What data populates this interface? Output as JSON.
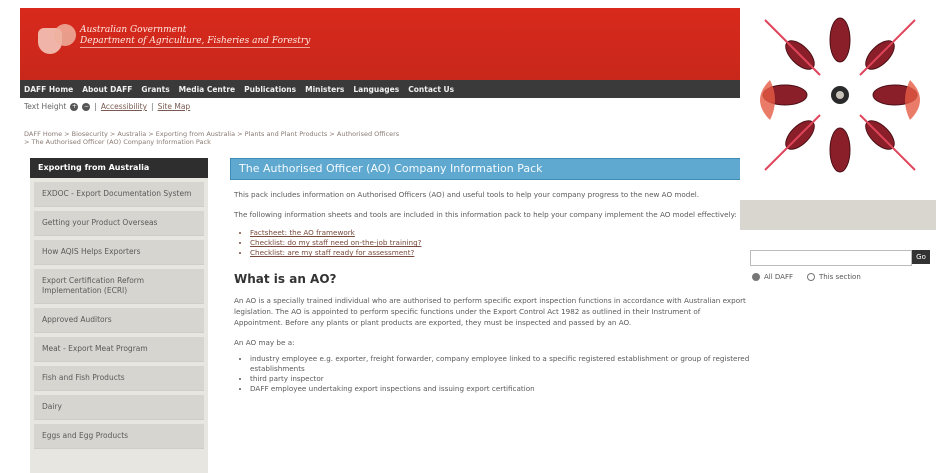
{
  "header": {
    "gov_line1": "Australian Government",
    "gov_line2": "Department of Agriculture, Fisheries and Forestry"
  },
  "nav": [
    "DAFF Home",
    "About DAFF",
    "Grants",
    "Media Centre",
    "Publications",
    "Ministers",
    "Languages",
    "Contact Us"
  ],
  "utility": {
    "text_size": "Text Height",
    "zoom_in": "+",
    "zoom_out": "−",
    "accessibility": "Accessibility",
    "sitemap": "Site Map"
  },
  "breadcrumb": [
    "DAFF Home > Biosecurity > Australia > Exporting from Australia > Plants and Plant Products > Authorised Officers",
    "> The Authorised Officer (AO) Company Information Pack"
  ],
  "sidebar": {
    "heading": "Exporting from Australia",
    "items": [
      "EXDOC - Export Documentation System",
      "Getting your Product Overseas",
      "How AQIS Helps Exporters",
      "Export Certification Reform Implementation (ECRI)",
      "Approved Auditors",
      "Meat - Export Meat Program",
      "Fish and Fish Products",
      "Dairy",
      "Eggs and Egg Products"
    ]
  },
  "main": {
    "title": "The Authorised Officer (AO) Company Information Pack",
    "intro": "This pack includes information on Authorised Officers (AO) and useful tools to help your company progress to the new AO model.",
    "intro2": "The following information sheets and tools are included in this information pack to help your company implement the AO model effectively:",
    "links": [
      "Factsheet: the AO framework",
      "Checklist: do my staff need on-the-job training?",
      "Checklist: are my staff ready for assessment?"
    ],
    "heading": "What is an AO?",
    "body": "An AO is a specially trained individual who are authorised to perform specific export inspection functions in accordance with Australian export legislation. The AO is appointed to perform specific functions under the Export Control Act 1982 as outlined in their Instrument of Appointment. Before any plants or plant products are exported, they must be inspected and passed by an AO.",
    "may_be": "An AO may be a:",
    "bullets": [
      "industry employee e.g. exporter, freight forwarder, company employee linked to a specific registered establishment or group of registered establishments",
      "third party inspector",
      "DAFF employee undertaking export inspections and issuing export certification"
    ]
  },
  "search": {
    "placeholder": "",
    "go": "Go",
    "scope_all": "All DAFF",
    "scope_section": "This section"
  },
  "colors": {
    "banner": "#d8291c",
    "nav_bg": "#3a3a3a",
    "title_blue": "#5fa8cf",
    "sidebar_bg": "#e7e6e0"
  }
}
